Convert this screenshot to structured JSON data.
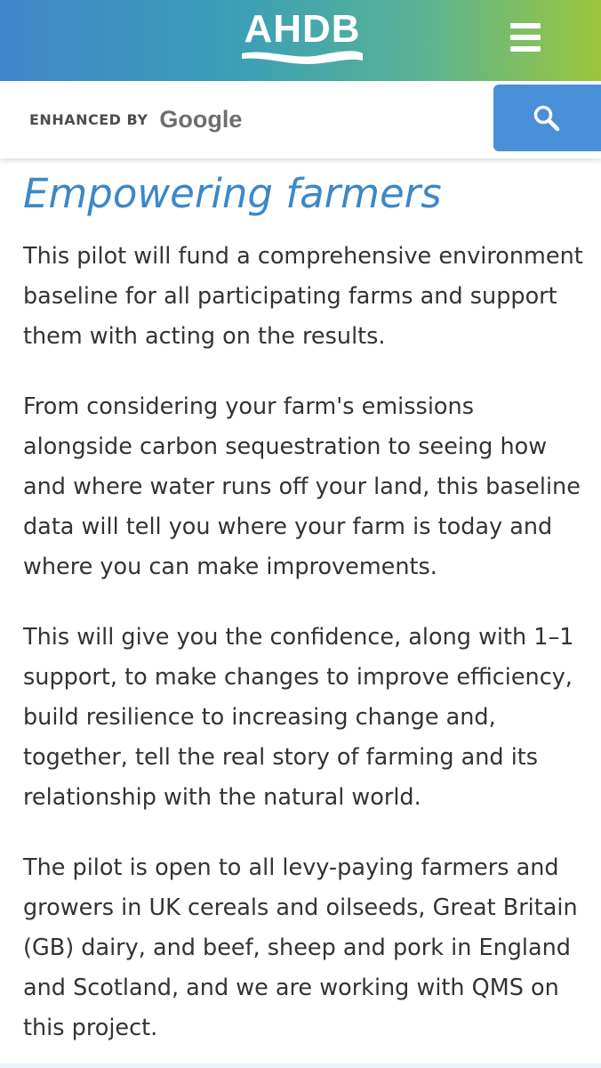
{
  "header": {
    "logo_text": "AHDB",
    "menu_icon": "hamburger-menu-icon",
    "gradient_colors": [
      "#3f86c9",
      "#3c9fb6",
      "#59b394",
      "#9cc63c"
    ]
  },
  "search": {
    "brand_prefix": "ENHANCED BY",
    "brand_name": "Google",
    "input_value": "",
    "button_icon": "search-icon",
    "button_color": "#4a90d8"
  },
  "article": {
    "title": "Empowering farmers",
    "title_color": "#3c88c8",
    "paragraphs": [
      "This pilot will fund a comprehensive environment baseline for all participating farms and support them with acting on the results.",
      "From considering your farm's emissions alongside carbon sequestration to seeing how and where water runs off your land, this baseline data will tell you where your farm is today and where you can make improvements.",
      "This will give you the confidence, along with 1–1 support, to make changes to improve efficiency, build resilience to increasing change and, together, tell the real story of farming and its relationship with the natural world.",
      "The pilot is open to all levy-paying farmers and growers in UK cereals and oilseeds, Great Britain (GB) dairy, and beef, sheep and pork in England and Scotland, and we are working with QMS on this project."
    ]
  }
}
